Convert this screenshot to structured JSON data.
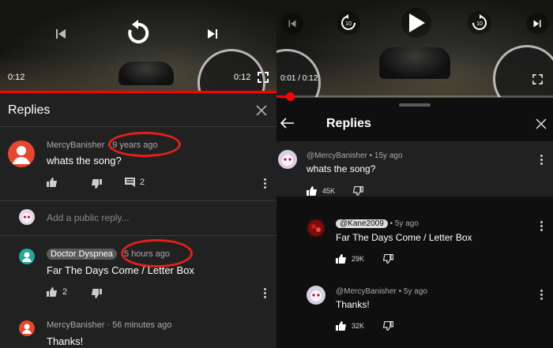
{
  "colors": {
    "accent_red": "#ff0000",
    "dark_bg": "#212121",
    "black_bg": "#0f0f0f",
    "annotation": "#e0211b"
  },
  "left": {
    "video": {
      "current_time": "0:12",
      "duration_badge": "0:12"
    },
    "header": {
      "title": "Replies",
      "close_icon": "close-icon"
    },
    "comments": [
      {
        "author": "MercyBanisher",
        "time": "9 years ago",
        "text": "whats the song?",
        "reply_count": "2"
      },
      {
        "author": "Doctor Dyspnea",
        "time": "5 hours ago",
        "text": "Far The Days Come / Letter Box",
        "likes": "2"
      },
      {
        "author": "MercyBanisher",
        "time": "56 minutes ago",
        "text": "Thanks!"
      }
    ],
    "reply_input": {
      "placeholder": "Add a public reply..."
    },
    "separator": "·"
  },
  "right": {
    "video": {
      "time": "0:01 / 0:12"
    },
    "header": {
      "title": "Replies"
    },
    "comments": [
      {
        "author": "@MercyBanisher",
        "time": "15y ago",
        "text": "whats the song?",
        "likes": "45K"
      },
      {
        "author": "@Kane2009",
        "time": "5y ago",
        "text": "Far The Days Come / Letter Box",
        "likes": "29K"
      },
      {
        "author": "@MercyBanisher",
        "time": "5y ago",
        "text": "Thanks!",
        "likes": "32K"
      }
    ],
    "separator": "•"
  }
}
